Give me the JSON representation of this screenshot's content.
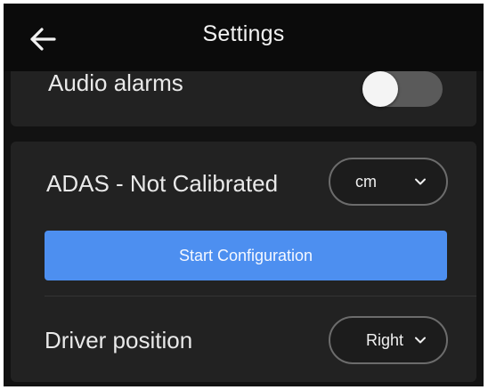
{
  "header": {
    "title": "Settings",
    "back_icon": "arrow-left-icon"
  },
  "audio": {
    "label": "Audio alarms",
    "toggle_on": false
  },
  "adas": {
    "label": "ADAS - Not Calibrated",
    "unit_value": "cm",
    "start_button_label": "Start Configuration",
    "accent_color": "#4d8ff0"
  },
  "driver": {
    "label": "Driver position",
    "value": "Right"
  }
}
